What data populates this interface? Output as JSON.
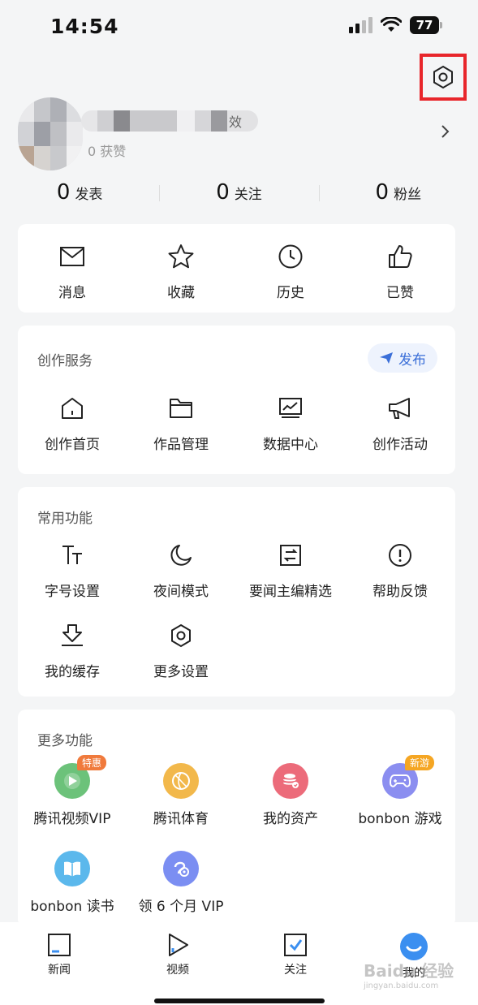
{
  "status_bar": {
    "time": "14:54",
    "battery": "77"
  },
  "profile": {
    "name_tag": "效",
    "likes_text": "0 获赞"
  },
  "stats": [
    {
      "num": "0",
      "label": "发表"
    },
    {
      "num": "0",
      "label": "关注"
    },
    {
      "num": "0",
      "label": "粉丝"
    }
  ],
  "quick": [
    {
      "label": "消息",
      "icon": "mail-icon"
    },
    {
      "label": "收藏",
      "icon": "star-icon"
    },
    {
      "label": "历史",
      "icon": "clock-icon"
    },
    {
      "label": "已赞",
      "icon": "thumb-up-icon"
    }
  ],
  "creation": {
    "title": "创作服务",
    "publish_label": "发布",
    "items": [
      {
        "label": "创作首页",
        "icon": "home-icon"
      },
      {
        "label": "作品管理",
        "icon": "folder-icon"
      },
      {
        "label": "数据中心",
        "icon": "chart-icon"
      },
      {
        "label": "创作活动",
        "icon": "megaphone-icon"
      }
    ]
  },
  "common": {
    "title": "常用功能",
    "items": [
      {
        "label": "字号设置",
        "icon": "font-size-icon"
      },
      {
        "label": "夜间模式",
        "icon": "moon-icon"
      },
      {
        "label": "要闻主编精选",
        "icon": "swap-icon"
      },
      {
        "label": "帮助反馈",
        "icon": "alert-icon"
      },
      {
        "label": "我的缓存",
        "icon": "download-icon"
      },
      {
        "label": "更多设置",
        "icon": "hex-gear-icon"
      }
    ]
  },
  "more": {
    "title": "更多功能",
    "items": [
      {
        "label": "腾讯视频VIP",
        "icon": "tencent-video-icon",
        "badge": "特惠",
        "color": "#6cc27a",
        "badge_color": "#f07a3c"
      },
      {
        "label": "腾讯体育",
        "icon": "sports-icon",
        "color": "#f2b84b"
      },
      {
        "label": "我的资产",
        "icon": "assets-icon",
        "color": "#ec6b7a"
      },
      {
        "label": "bonbon 游戏",
        "icon": "gamepad-icon",
        "badge": "新游",
        "color": "#8b8ef0",
        "badge_color": "#f5a623"
      },
      {
        "label": "bonbon 读书",
        "icon": "book-icon",
        "color": "#5bb8ec"
      },
      {
        "label": "领 6 个月 VIP",
        "icon": "vip-icon",
        "color": "#7b8ef2"
      }
    ]
  },
  "nav": [
    {
      "label": "新闻",
      "icon": "news-icon"
    },
    {
      "label": "视频",
      "icon": "video-icon"
    },
    {
      "label": "关注",
      "icon": "follow-icon"
    },
    {
      "label": "我的",
      "icon": "me-icon"
    }
  ],
  "watermark": {
    "brand": "Baidu 经验",
    "url": "jingyan.baidu.com"
  },
  "colors": {
    "highlight": "#e8262b",
    "accent": "#3b6fd8"
  }
}
